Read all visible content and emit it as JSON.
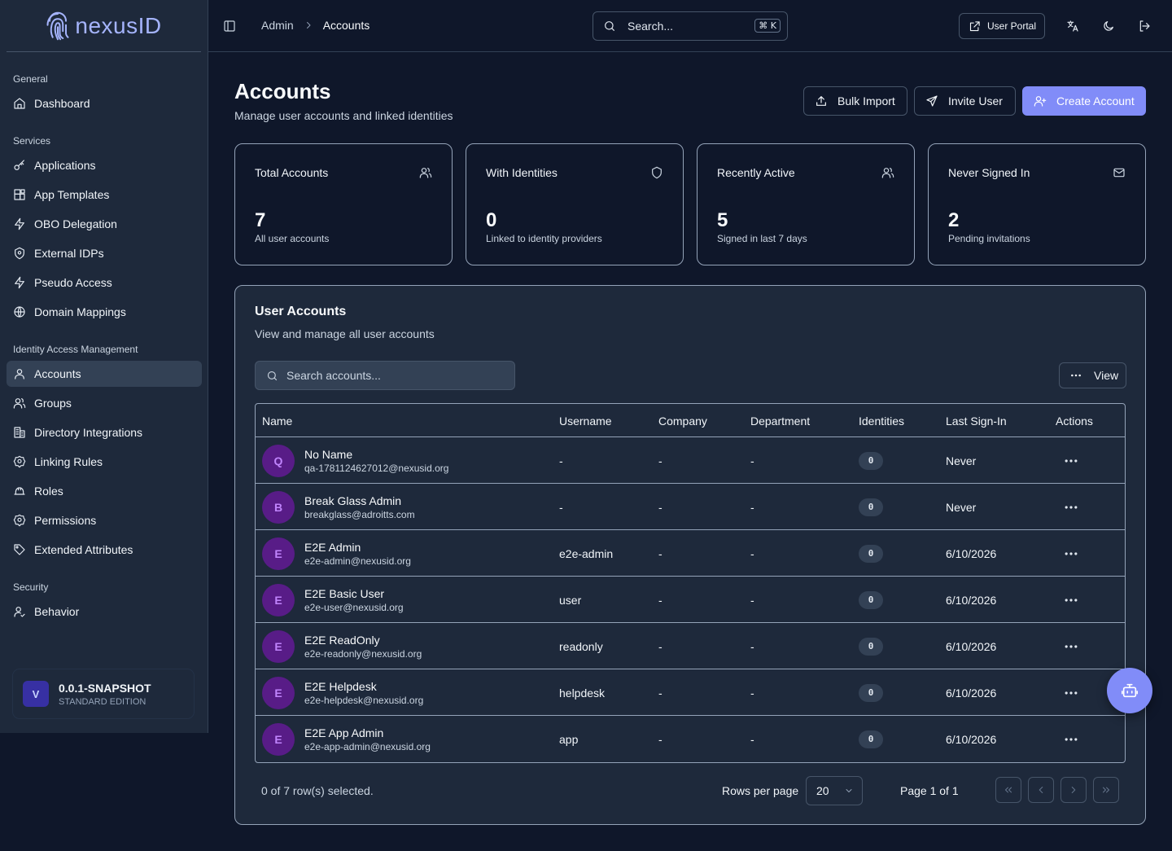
{
  "app": {
    "brand": "nexusID"
  },
  "sidebar": {
    "sections": [
      {
        "label": "General",
        "items": [
          {
            "label": "Dashboard",
            "icon": "home-icon"
          }
        ]
      },
      {
        "label": "Services",
        "items": [
          {
            "label": "Applications",
            "icon": "key-icon"
          },
          {
            "label": "App Templates",
            "icon": "blocks-icon"
          },
          {
            "label": "OBO Delegation",
            "icon": "zap-icon"
          },
          {
            "label": "External IDPs",
            "icon": "shield-icon"
          },
          {
            "label": "Pseudo Access",
            "icon": "zap-icon"
          },
          {
            "label": "Domain Mappings",
            "icon": "globe-icon"
          }
        ]
      },
      {
        "label": "Identity Access Management",
        "items": [
          {
            "label": "Accounts",
            "icon": "user-icon"
          },
          {
            "label": "Groups",
            "icon": "users-icon"
          },
          {
            "label": "Directory Integrations",
            "icon": "building-icon"
          },
          {
            "label": "Linking Rules",
            "icon": "badge-icon"
          },
          {
            "label": "Roles",
            "icon": "hat-icon"
          },
          {
            "label": "Permissions",
            "icon": "badge-icon"
          },
          {
            "label": "Extended Attributes",
            "icon": "tag-icon"
          }
        ]
      },
      {
        "label": "Security",
        "items": [
          {
            "label": "Behavior",
            "icon": "user-check-icon"
          }
        ]
      }
    ],
    "version": {
      "badge": "V",
      "title": "0.0.1-SNAPSHOT",
      "edition": "STANDARD EDITION"
    }
  },
  "header": {
    "breadcrumb": [
      "Admin",
      "Accounts"
    ],
    "search_placeholder": "Search...",
    "search_shortcut": "⌘ K",
    "user_portal": "User Portal"
  },
  "page": {
    "title": "Accounts",
    "subtitle": "Manage user accounts and linked identities",
    "actions": {
      "bulk_import": "Bulk Import",
      "invite_user": "Invite User",
      "create_account": "Create Account"
    },
    "stats": [
      {
        "title": "Total Accounts",
        "value": "7",
        "desc": "All user accounts",
        "icon": "users-icon"
      },
      {
        "title": "With Identities",
        "value": "0",
        "desc": "Linked to identity providers",
        "icon": "shield-icon"
      },
      {
        "title": "Recently Active",
        "value": "5",
        "desc": "Signed in last 7 days",
        "icon": "users-icon"
      },
      {
        "title": "Never Signed In",
        "value": "2",
        "desc": "Pending invitations",
        "icon": "mail-icon"
      }
    ]
  },
  "table": {
    "title": "User Accounts",
    "subtitle": "View and manage all user accounts",
    "search_placeholder": "Search accounts...",
    "view_label": "View",
    "columns": [
      "Name",
      "Username",
      "Company",
      "Department",
      "Identities",
      "Last Sign-In",
      "Actions"
    ],
    "rows": [
      {
        "initial": "Q",
        "name": "No Name",
        "email": "qa-1781124627012@nexusid.org",
        "username": "-",
        "company": "-",
        "department": "-",
        "identities": "0",
        "last_sign_in": "Never"
      },
      {
        "initial": "B",
        "name": "Break Glass Admin",
        "email": "breakglass@adroitts.com",
        "username": "-",
        "company": "-",
        "department": "-",
        "identities": "0",
        "last_sign_in": "Never"
      },
      {
        "initial": "E",
        "name": "E2E Admin",
        "email": "e2e-admin@nexusid.org",
        "username": "e2e-admin",
        "company": "-",
        "department": "-",
        "identities": "0",
        "last_sign_in": "6/10/2026"
      },
      {
        "initial": "E",
        "name": "E2E Basic User",
        "email": "e2e-user@nexusid.org",
        "username": "user",
        "company": "-",
        "department": "-",
        "identities": "0",
        "last_sign_in": "6/10/2026"
      },
      {
        "initial": "E",
        "name": "E2E ReadOnly",
        "email": "e2e-readonly@nexusid.org",
        "username": "readonly",
        "company": "-",
        "department": "-",
        "identities": "0",
        "last_sign_in": "6/10/2026"
      },
      {
        "initial": "E",
        "name": "E2E Helpdesk",
        "email": "e2e-helpdesk@nexusid.org",
        "username": "helpdesk",
        "company": "-",
        "department": "-",
        "identities": "0",
        "last_sign_in": "6/10/2026"
      },
      {
        "initial": "E",
        "name": "E2E App Admin",
        "email": "e2e-app-admin@nexusid.org",
        "username": "app",
        "company": "-",
        "department": "-",
        "identities": "0",
        "last_sign_in": "6/10/2026"
      }
    ],
    "footer": {
      "selection": "0 of 7 row(s) selected.",
      "rows_per_page_label": "Rows per page",
      "rows_per_page": "20",
      "page_label": "Page 1 of 1"
    }
  },
  "colors": {
    "accent": "#818cf8",
    "avatar_bg": "#581c87",
    "avatar_text": "#c084fc",
    "background": "#0f172a",
    "surface": "#1e293b"
  }
}
